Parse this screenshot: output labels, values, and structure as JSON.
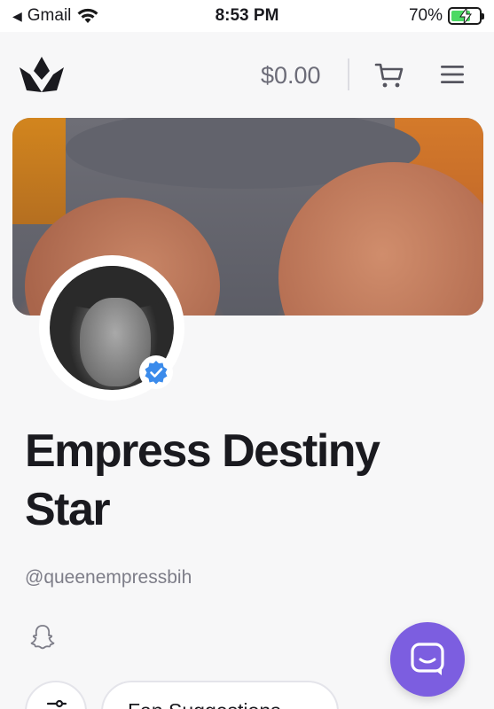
{
  "status_bar": {
    "back_app": "Gmail",
    "time": "8:53 PM",
    "battery": "70%",
    "battery_level": 0.7
  },
  "header": {
    "balance": "$0.00",
    "icons": [
      "crown-logo-icon",
      "cart-icon",
      "hamburger-menu-icon"
    ]
  },
  "profile": {
    "name": "Empress Destiny Star",
    "handle": "@queenempressbih",
    "verified": true,
    "social_icons": [
      "snapchat-icon"
    ]
  },
  "chips": {
    "fan_suggestions": "Fan Suggestions"
  },
  "colors": {
    "accent": "#7c5ee0",
    "verified_blue": "#3b8beb",
    "muted_text": "#7d7d88"
  }
}
